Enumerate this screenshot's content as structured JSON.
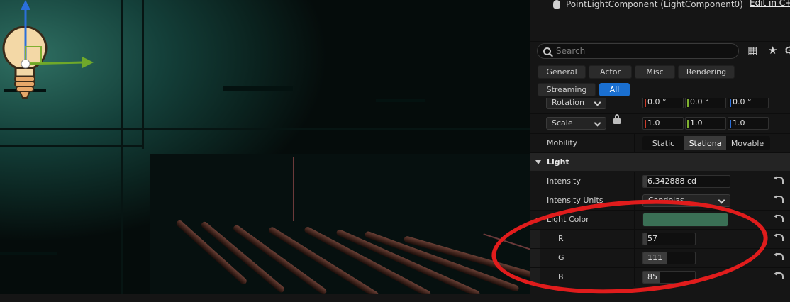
{
  "viewport": {
    "description_icons": [
      "light-bulb-icon",
      "translate-gizmo-icon"
    ]
  },
  "details": {
    "component_name": "PointLightComponent (LightComponent0)",
    "edit_link": "Edit in C++",
    "search_placeholder": "Search",
    "tabs": [
      "General",
      "Actor",
      "Misc",
      "Rendering",
      "Streaming",
      "All"
    ],
    "active_tab": "All",
    "transform": {
      "rotation_label": "Rotation",
      "rotation": [
        "0.0 °",
        "0.0 °",
        "0.0 °"
      ],
      "scale_label": "Scale",
      "scale": [
        "1.0",
        "1.0",
        "1.0"
      ]
    },
    "mobility": {
      "label": "Mobility",
      "options": [
        "Static",
        "Stationa",
        "Movable"
      ],
      "selected": "Stationa"
    },
    "light_section": {
      "title": "Light",
      "intensity_label": "Intensity",
      "intensity_value": "6.342888 cd",
      "intensity_units_label": "Intensity Units",
      "intensity_units_value": "Candelas",
      "light_color_label": "Light Color",
      "light_color_hex": "#3a6f55",
      "r_label": "R",
      "r_value": "57",
      "g_label": "G",
      "g_value": "111",
      "b_label": "B",
      "b_value": "85"
    }
  },
  "colors": {
    "accent": "#1a6fd0",
    "annotation": "#e01c1c",
    "axis_x": "#c83a2a",
    "axis_y": "#7fb030",
    "axis_z": "#2b6fd9"
  }
}
